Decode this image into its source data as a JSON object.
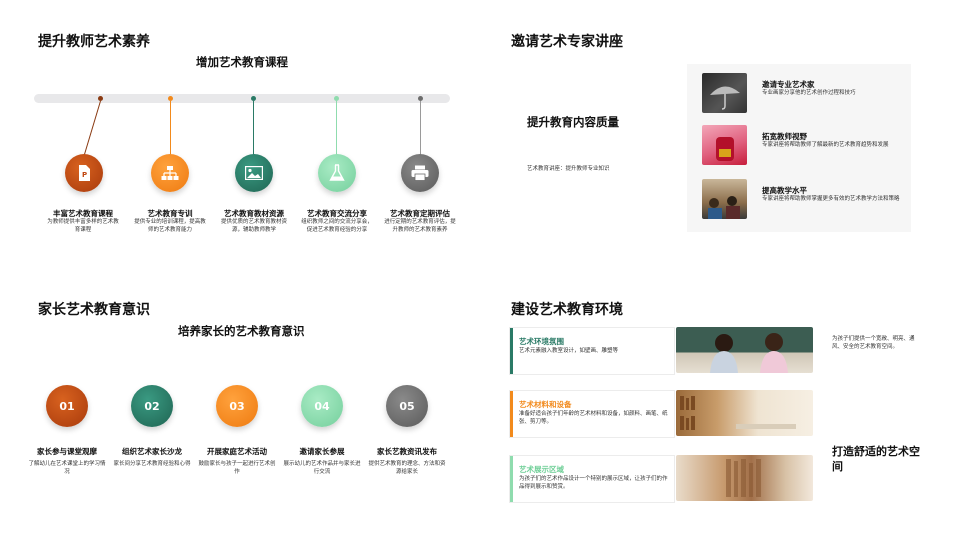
{
  "q1": {
    "title": "提升教师艺术素养",
    "subtitle": "增加艺术教育课程",
    "items": [
      {
        "title": "丰富艺术教育课程",
        "desc": "为教师提供丰富多样的艺术教育课程",
        "color": "#c0460f",
        "icon": "document-icon"
      },
      {
        "title": "艺术教育专训",
        "desc": "提供专业的培训课程，提高教师的艺术教育能力",
        "color": "#f28a1c",
        "icon": "org-chart-icon"
      },
      {
        "title": "艺术教育教材资源",
        "desc": "提供优质的艺术教育教材资源，辅助教师教学",
        "color": "#2a7a66",
        "icon": "image-icon"
      },
      {
        "title": "艺术教育交流分享",
        "desc": "组织教师之间的交流分享会，促进艺术教育经验的分享",
        "color": "#8fdcae",
        "icon": "flask-icon"
      },
      {
        "title": "艺术教育定期评估",
        "desc": "进行定期的艺术教育评估，提升教师的艺术教育素养",
        "color": "#6c6c6c",
        "icon": "printer-icon"
      }
    ]
  },
  "q2": {
    "title": "邀请艺术专家讲座",
    "subtitle": "提升教育内容质量",
    "note": "艺术教育讲座：提升教师专业知识",
    "items": [
      {
        "title": "邀请专业艺术家",
        "desc": "专业画家分享他的艺术创作过程和技巧"
      },
      {
        "title": "拓宽教师视野",
        "desc": "专家讲座将帮助教师了解最新的艺术教育趋势和发展"
      },
      {
        "title": "提高教学水平",
        "desc": "专家讲座将帮助教师掌握更多有效的艺术教学方法和策略"
      }
    ]
  },
  "q3": {
    "title": "家长艺术教育意识",
    "subtitle": "培养家长的艺术教育意识",
    "items": [
      {
        "num": "01",
        "title": "家长参与课堂观摩",
        "desc": "了解幼儿在艺术课堂上的学习情况",
        "color": "#c0460f"
      },
      {
        "num": "02",
        "title": "组织艺术家长沙龙",
        "desc": "家长间分享艺术教育经验和心得",
        "color": "#2a7a66"
      },
      {
        "num": "03",
        "title": "开展家庭艺术活动",
        "desc": "鼓励家长与孩子一起进行艺术创作",
        "color": "#f28a1c"
      },
      {
        "num": "04",
        "title": "邀请家长参展",
        "desc": "展示幼儿的艺术作品并与家长进行交流",
        "color": "#8fdcae"
      },
      {
        "num": "05",
        "title": "家长艺教资讯发布",
        "desc": "提供艺术教育的理念、方法和资源给家长",
        "color": "#6c6c6c"
      }
    ]
  },
  "q4": {
    "title": "建设艺术教育环境",
    "side_text": "为孩子们提供一个宽敞、明亮、通风、安全的艺术教育空间。",
    "big_text": "打造舒适的艺术空间",
    "items": [
      {
        "title": "艺术环境氛围",
        "desc": "艺术元素融入教室设计，如壁画、雕塑等",
        "color": "#2a7a66"
      },
      {
        "title": "艺术材料和设备",
        "desc": "准备好适合孩子们年龄的艺术材料和设备，如颜料、画笔、纸张、剪刀等。",
        "color": "#f28a1c"
      },
      {
        "title": "艺术展示区域",
        "desc": "为孩子们的艺术作品设计一个特别的展示区域，让孩子们的作品得到展示和赞赏。",
        "color": "#8fdcae"
      }
    ]
  }
}
